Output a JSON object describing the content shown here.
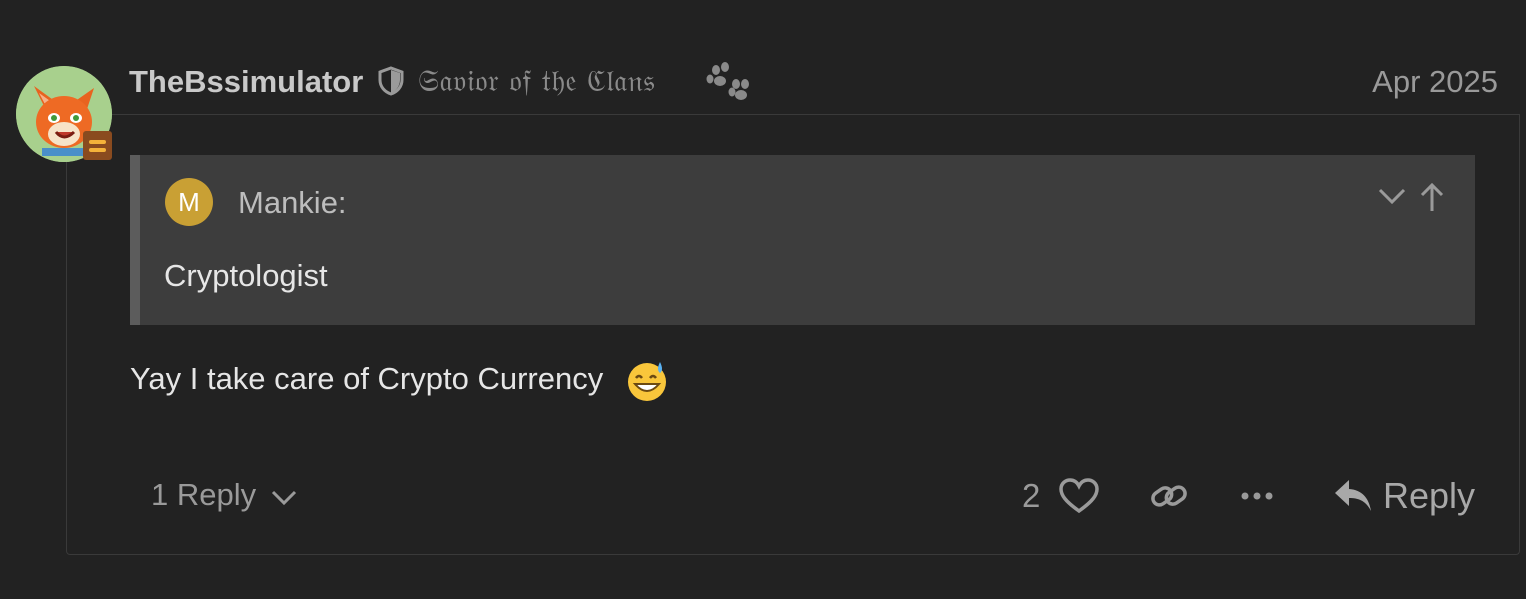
{
  "post": {
    "username": "TheBssimulator",
    "user_title": "𝔖𝔞𝔳𝔦𝔬𝔯 𝔬𝔣 𝔱𝔥𝔢 ℭ𝔩𝔞𝔫𝔰",
    "date": "Apr 2025",
    "quote": {
      "avatar_letter": "M",
      "author": "Mankie:",
      "text": "Cryptologist"
    },
    "body": "Yay I take care of Crypto Currency",
    "emoji": "sweat-smile"
  },
  "actions": {
    "replies_label": "1 Reply",
    "like_count": "2",
    "reply_label": "Reply"
  },
  "icons": [
    "shield-icon",
    "paw-icon",
    "chevron-down-icon",
    "arrow-up-icon",
    "heart-icon",
    "link-icon",
    "more-icon",
    "reply-arrow-icon"
  ],
  "colors": {
    "background": "#222222",
    "quote_background": "#3d3d3d",
    "quote_avatar": "#c9a034",
    "muted_text": "#9a9a9a"
  }
}
